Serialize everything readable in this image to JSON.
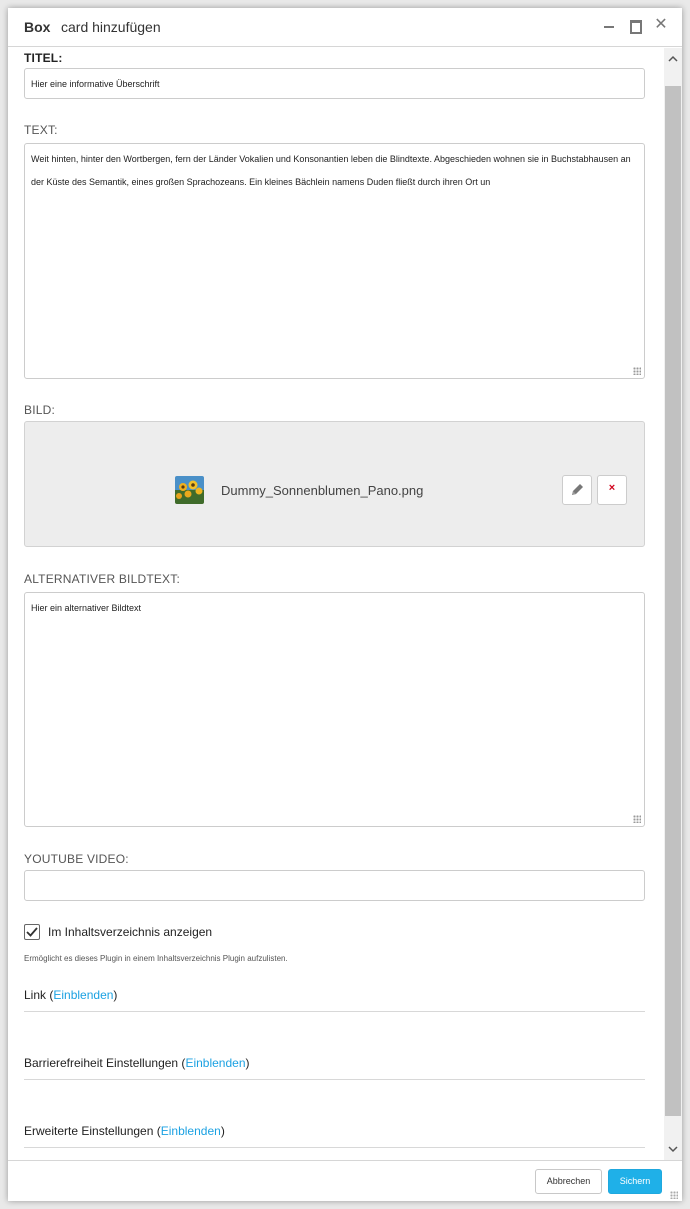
{
  "dialog": {
    "title_type": "Box",
    "title_action": "card hinzufügen",
    "controls": {
      "minimize_icon": "minimize-icon",
      "maximize_icon": "maximize-icon",
      "close_icon": "close-icon",
      "close_glyph": "✕"
    }
  },
  "form": {
    "titel": {
      "label": "TITEL:",
      "value": "Hier eine informative Überschrift"
    },
    "text": {
      "label": "TEXT:",
      "value": "Weit hinten, hinter den Wortbergen, fern der Länder Vokalien und Konsonantien leben die Blindtexte. Abgeschieden wohnen sie in Buchstabhausen an der Küste des Semantik, eines großen Sprachozeans. Ein kleines Bächlein namens Duden fließt durch ihren Ort un"
    },
    "bild": {
      "label": "BILD:",
      "filename": "Dummy_Sonnenblumen_Pano.png",
      "edit_icon": "pencil-icon",
      "remove_icon": "remove-icon",
      "remove_glyph": "×"
    },
    "alt_text": {
      "label": "ALTERNATIVER BILDTEXT:",
      "value": "Hier ein alternativer Bildtext"
    },
    "youtube": {
      "label": "YOUTUBE VIDEO:",
      "value": ""
    },
    "toc": {
      "checked": true,
      "label": "Im Inhaltsverzeichnis anzeigen",
      "hint": "Ermöglicht es dieses Plugin in einem Inhaltsverzeichnis Plugin aufzulisten."
    },
    "sections": [
      {
        "title": "Link",
        "toggle": "Einblenden"
      },
      {
        "title": "Barrierefreiheit Einstellungen",
        "toggle": "Einblenden"
      },
      {
        "title": "Erweiterte Einstellungen",
        "toggle": "Einblenden"
      }
    ]
  },
  "footer": {
    "cancel_label": "Abbrechen",
    "save_label": "Sichern"
  },
  "colors": {
    "accent": "#1fb0e8",
    "link": "#1ba1e2",
    "remove": "#d0021b"
  }
}
